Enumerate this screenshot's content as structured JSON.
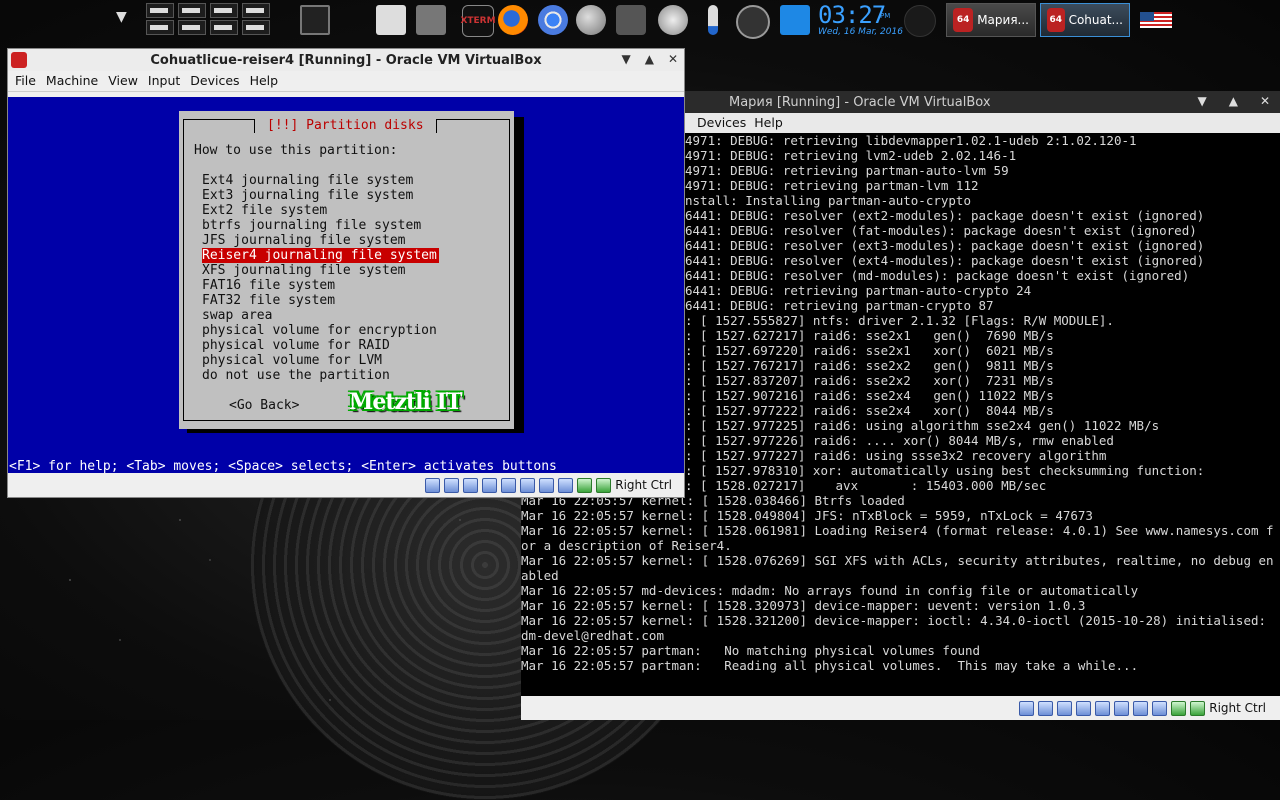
{
  "taskbar": {
    "clock_time": "03:27",
    "clock_ampm": "PM",
    "clock_date": "Wed, 16 Mar, 2016",
    "xterm_label": "XTERM",
    "tasks": [
      {
        "label": "Мария..."
      },
      {
        "label": "Cohuat..."
      }
    ],
    "icons": [
      "chevron-down-icon",
      "workspace-pager",
      "terminal-icon",
      "mac-icon",
      "tv-icon",
      "xterm-icon",
      "firefox-icon",
      "chrome-icon",
      "globe-icon",
      "camera-icon",
      "lightbulb-icon",
      "thermometer-icon",
      "gauge-icon",
      "calendar-icon",
      "moon-icon",
      "us-flag-icon"
    ]
  },
  "window1": {
    "title": "Cohuatlicue-reiser4 [Running] - Oracle VM VirtualBox",
    "menu": [
      "File",
      "Machine",
      "View",
      "Input",
      "Devices",
      "Help"
    ],
    "dialog": {
      "title": "[!!] Partition disks",
      "prompt": "How to use this partition:",
      "options": [
        "Ext4 journaling file system",
        "Ext3 journaling file system",
        "Ext2 file system",
        "btrfs journaling file system",
        "JFS journaling file system",
        "Reiser4 journaling file system",
        "XFS journaling file system",
        "FAT16 file system",
        "FAT32 file system",
        "swap area",
        "physical volume for encryption",
        "physical volume for RAID",
        "physical volume for LVM",
        "do not use the partition"
      ],
      "selected_index": 5,
      "go_back": "<Go Back>",
      "logo": "Metztli IT"
    },
    "help_line": "<F1> for help; <Tab> moves; <Space> selects; <Enter> activates buttons",
    "host_key": "Right Ctrl"
  },
  "window2": {
    "title": "Мария [Running] - Oracle VM VirtualBox",
    "menu": [
      "Devices",
      "Help"
    ],
    "console": [
      "                                                                                       4971: DEBUG: retrieving libdevmapper1.02.1-udeb 2:1.02.120-1",
      "                                                                                       4971: DEBUG: retrieving lvm2-udeb 2.02.146-1",
      "                                                                                       4971: DEBUG: retrieving partman-auto-lvm 59",
      "                                                                                       4971: DEBUG: retrieving partman-lvm 112",
      "                                                                                       nstall: Installing partman-auto-crypto",
      "                                                                                       6441: DEBUG: resolver (ext2-modules): package doesn't exist (ignored)",
      "                                                                                       6441: DEBUG: resolver (fat-modules): package doesn't exist (ignored)",
      "                                                                                       6441: DEBUG: resolver (ext3-modules): package doesn't exist (ignored)",
      "                                                                                       6441: DEBUG: resolver (ext4-modules): package doesn't exist (ignored)",
      "                                                                                       6441: DEBUG: resolver (md-modules): package doesn't exist (ignored)",
      "                                                                                       6441: DEBUG: retrieving partman-auto-crypto 24",
      "                                                                                       6441: DEBUG: retrieving partman-crypto 87",
      "                                                                                       : [ 1527.555827] ntfs: driver 2.1.32 [Flags: R/W MODULE].",
      "                                                                                       : [ 1527.627217] raid6: sse2x1   gen()  7690 MB/s",
      "                                                                                       : [ 1527.697220] raid6: sse2x1   xor()  6021 MB/s",
      "                                                                                       : [ 1527.767217] raid6: sse2x2   gen()  9811 MB/s",
      "                                                                                       : [ 1527.837207] raid6: sse2x2   xor()  7231 MB/s",
      "                                                                                       : [ 1527.907216] raid6: sse2x4   gen() 11022 MB/s",
      "                                                                                       : [ 1527.977222] raid6: sse2x4   xor()  8044 MB/s",
      "                                                                                       : [ 1527.977225] raid6: using algorithm sse2x4 gen() 11022 MB/s",
      "                                                                                       : [ 1527.977226] raid6: .... xor() 8044 MB/s, rmw enabled",
      "                                                                                       : [ 1527.977227] raid6: using ssse3x2 recovery algorithm",
      "                                                                                       : [ 1527.978310] xor: automatically using best checksumming function:",
      "                                                                                       : [ 1528.027217]    avx       : 15403.000 MB/sec",
      "Mar 16 22:05:57 kernel: [ 1528.038466] Btrfs loaded",
      "Mar 16 22:05:57 kernel: [ 1528.049804] JFS: nTxBlock = 5959, nTxLock = 47673",
      "Mar 16 22:05:57 kernel: [ 1528.061981] Loading Reiser4 (format release: 4.0.1) See www.namesys.com f",
      "or a description of Reiser4.",
      "Mar 16 22:05:57 kernel: [ 1528.076269] SGI XFS with ACLs, security attributes, realtime, no debug en",
      "abled",
      "Mar 16 22:05:57 md-devices: mdadm: No arrays found in config file or automatically",
      "Mar 16 22:05:57 kernel: [ 1528.320973] device-mapper: uevent: version 1.0.3",
      "Mar 16 22:05:57 kernel: [ 1528.321200] device-mapper: ioctl: 4.34.0-ioctl (2015-10-28) initialised:",
      "dm-devel@redhat.com",
      "Mar 16 22:05:57 partman:   No matching physical volumes found",
      "Mar 16 22:05:57 partman:   Reading all physical volumes.  This may take a while..."
    ],
    "host_key": "Right Ctrl"
  }
}
